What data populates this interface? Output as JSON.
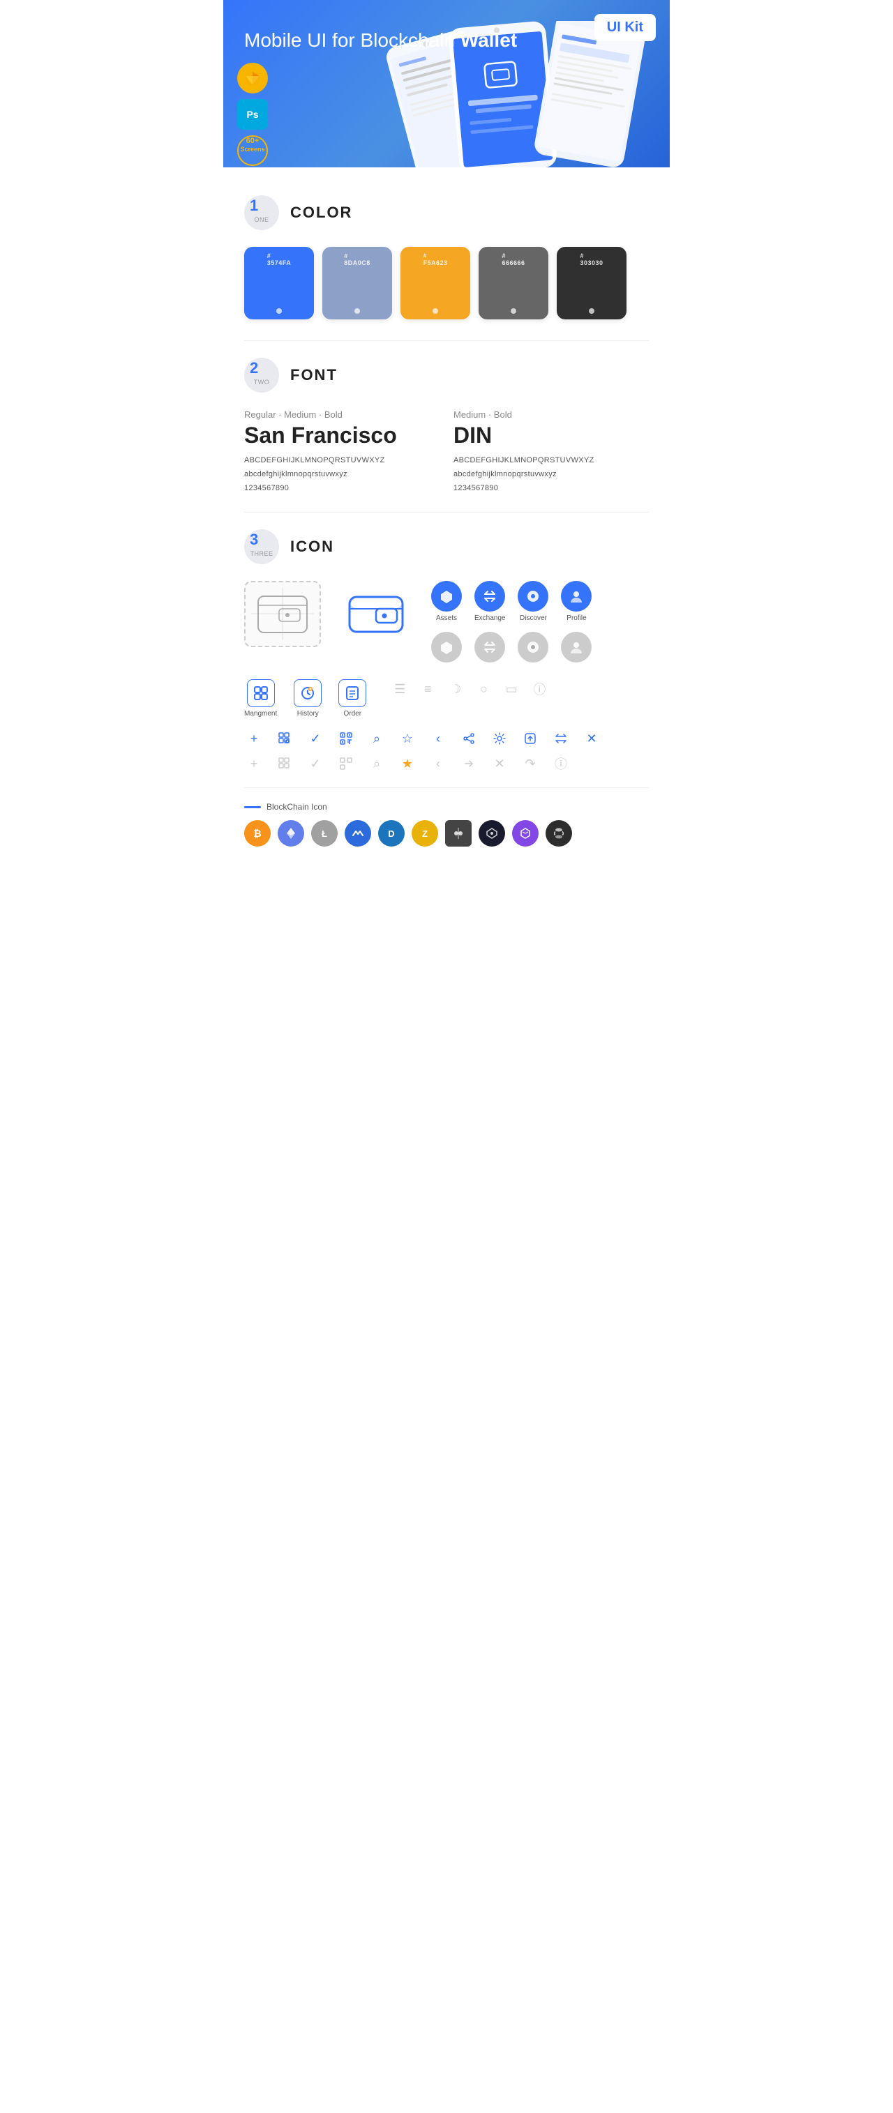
{
  "hero": {
    "title_part1": "Mobile UI for Blockchain ",
    "title_part2": "Wallet",
    "badge": "UI Kit",
    "sketch_label": "Sk",
    "ps_label": "Ps",
    "screens_label": "60+\nScreens"
  },
  "sections": {
    "color": {
      "number": "1",
      "sub": "ONE",
      "title": "COLOR",
      "swatches": [
        {
          "hex": "#3574FA",
          "label": "#\n3574FA",
          "dot_color": "#fff"
        },
        {
          "hex": "#8DA0C8",
          "label": "#\n8DA0C8",
          "dot_color": "#fff"
        },
        {
          "hex": "#F5A623",
          "label": "#\nF5A623",
          "dot_color": "#fff"
        },
        {
          "hex": "#666666",
          "label": "#\n666666",
          "dot_color": "#fff"
        },
        {
          "hex": "#303030",
          "label": "#\n303030",
          "dot_color": "#fff"
        }
      ]
    },
    "font": {
      "number": "2",
      "sub": "TWO",
      "title": "FONT",
      "fonts": [
        {
          "style": "Regular · Medium · Bold",
          "name": "San Francisco",
          "uppercase": "ABCDEFGHIJKLMNOPQRSTUVWXYZ",
          "lowercase": "abcdefghijklmnopqrstuvwxyz",
          "numbers": "1234567890"
        },
        {
          "style": "Medium · Bold",
          "name": "DIN",
          "uppercase": "ABCDEFGHIJKLMNOPQRSTUVWXYZ",
          "lowercase": "abcdefghijklmnopqrstuvwxyz",
          "numbers": "1234567890"
        }
      ]
    },
    "icon": {
      "number": "3",
      "sub": "THREE",
      "title": "ICON",
      "tab_icons": [
        {
          "label": "Assets",
          "symbol": "◆"
        },
        {
          "label": "Exchange",
          "symbol": "⇄"
        },
        {
          "label": "Discover",
          "symbol": "●"
        },
        {
          "label": "Profile",
          "symbol": "◔"
        }
      ],
      "tab_icons_gray": [
        {
          "symbol": "◆"
        },
        {
          "symbol": "⇄"
        },
        {
          "symbol": "●"
        },
        {
          "symbol": "◔"
        }
      ],
      "app_icons": [
        {
          "label": "Mangment",
          "type": "box"
        },
        {
          "label": "History",
          "type": "clock"
        },
        {
          "label": "Order",
          "type": "list"
        }
      ],
      "small_icons_blue": [
        "☰",
        "≡",
        "✓",
        "⊞",
        "⌕",
        "☆",
        "‹",
        "≮",
        "⚙",
        "⊡",
        "⇌",
        "✕"
      ],
      "small_icons_gray": [
        "+",
        "⊟",
        "✓",
        "⊞",
        "⌕",
        "☆",
        "‹",
        "⇋",
        "✕",
        "↷",
        "ℹ"
      ],
      "blockchain_label": "BlockChain Icon",
      "crypto_coins": [
        {
          "name": "BTC",
          "color": "#F7931A",
          "symbol": "₿"
        },
        {
          "name": "ETH",
          "color": "#627EEA",
          "symbol": "Ξ"
        },
        {
          "name": "LTC",
          "color": "#A0A0A0",
          "symbol": "Ł"
        },
        {
          "name": "WAVES",
          "color": "#1F5AF6",
          "symbol": "W"
        },
        {
          "name": "DASH",
          "color": "#1C75BC",
          "symbol": "D"
        },
        {
          "name": "ZEC",
          "color": "#E8B20A",
          "symbol": "Z"
        },
        {
          "name": "IOTA",
          "color": "#555555",
          "symbol": "I"
        },
        {
          "name": "ADA",
          "color": "#0D1E2D",
          "symbol": "A"
        },
        {
          "name": "MATIC",
          "color": "#8247E5",
          "symbol": "M"
        },
        {
          "name": "DOT",
          "color": "#E6007A",
          "symbol": "●"
        }
      ]
    }
  }
}
